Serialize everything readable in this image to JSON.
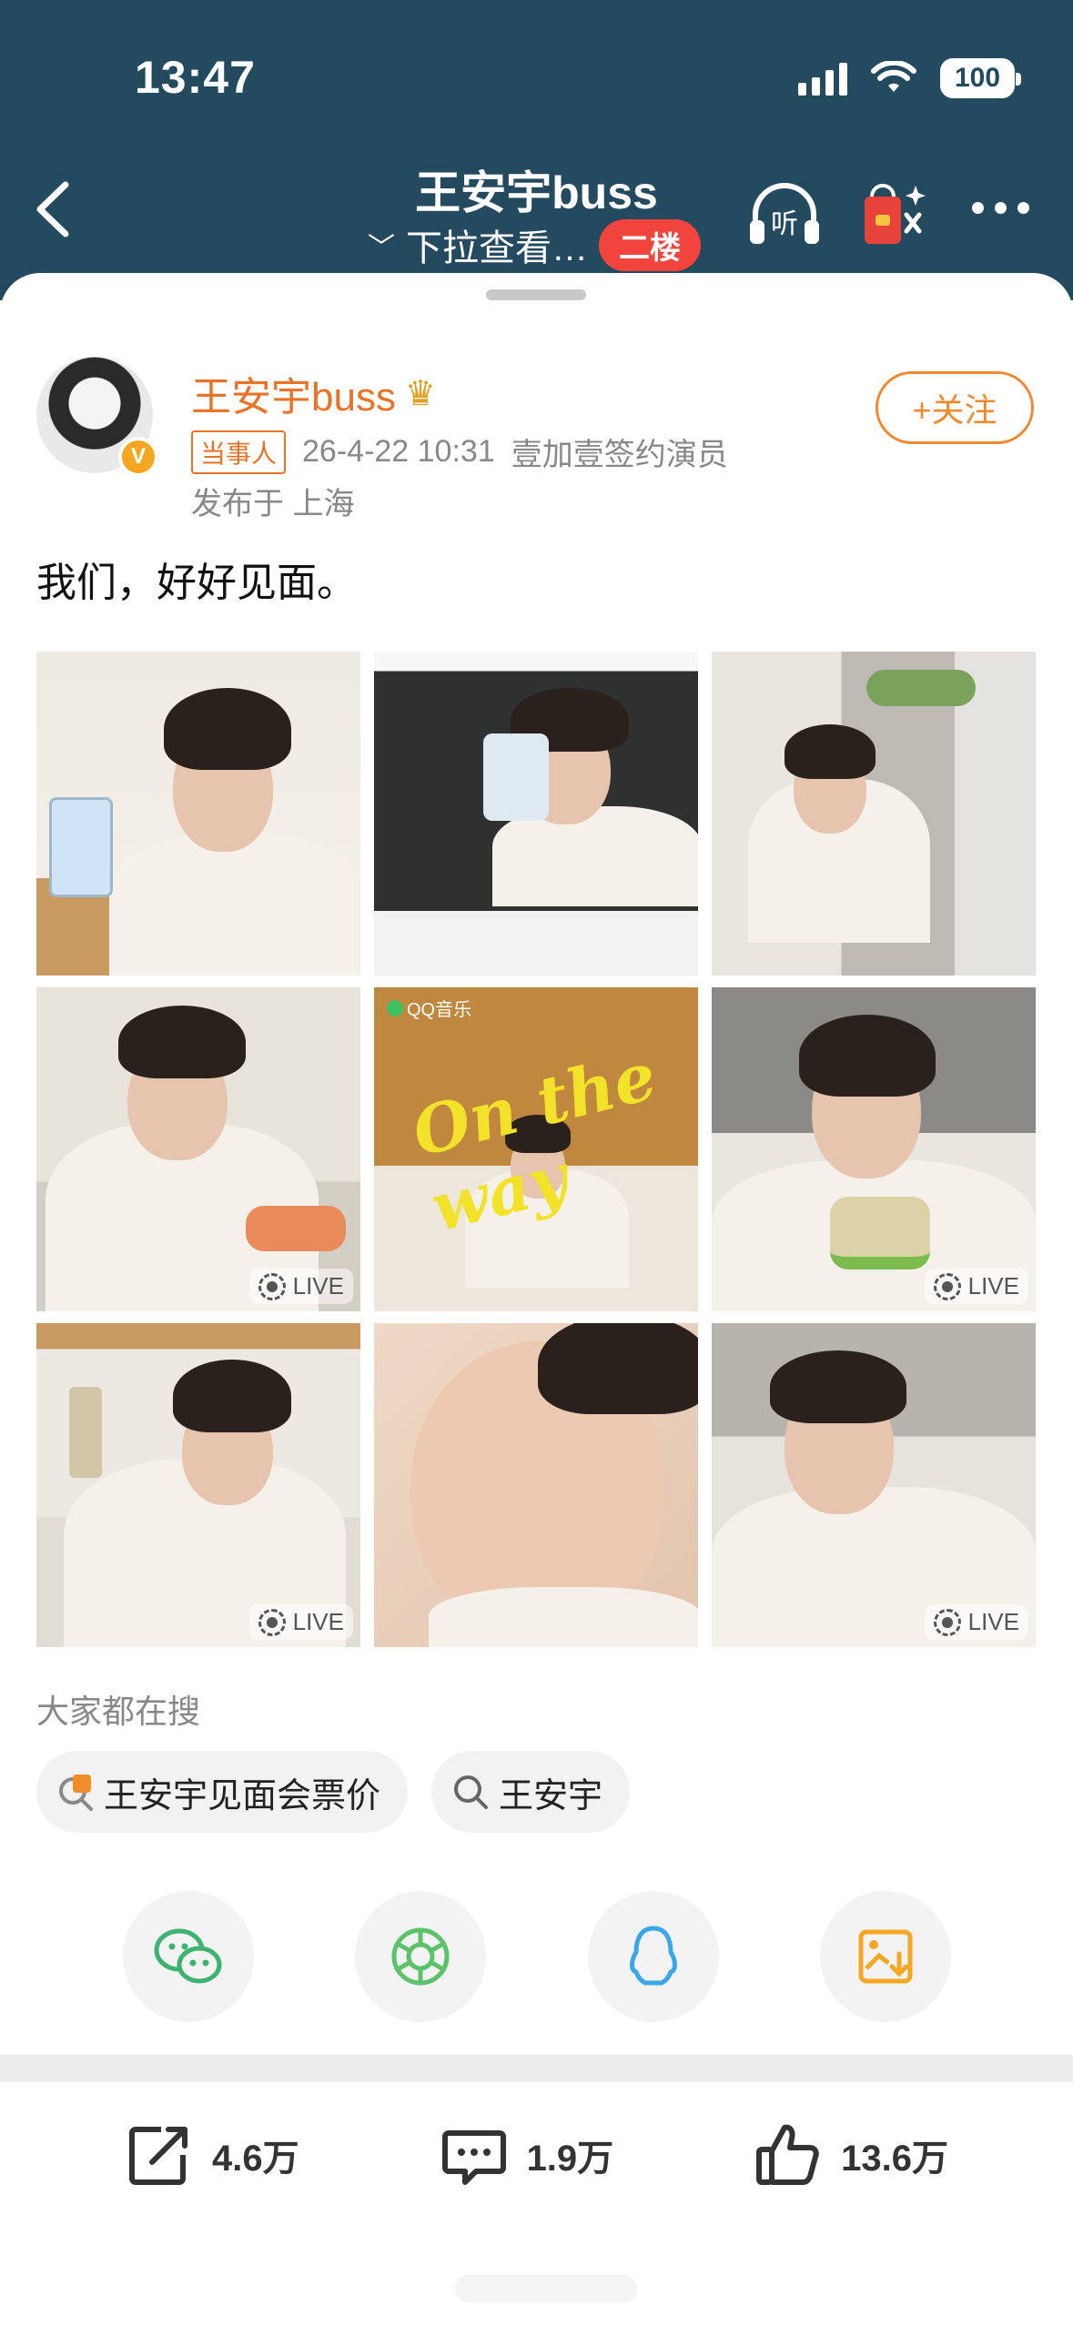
{
  "status_bar": {
    "time": "13:47",
    "battery": "100"
  },
  "nav": {
    "title": "王安宇buss",
    "subtitle": "下拉查看…",
    "floor_badge": "二楼",
    "listen_label": "听"
  },
  "post": {
    "author": "王安宇buss",
    "tag": "当事人",
    "timestamp": "26-4-22 10:31",
    "source": "壹加壹签约演员",
    "location": "发布于 上海",
    "follow_label": "+关注",
    "verified_mark": "V",
    "text": "我们，好好见面。",
    "live_label": "LIVE",
    "qq_music_mark": "QQ音乐",
    "artwork_text": "On the way"
  },
  "search": {
    "title": "大家都在搜",
    "chips": [
      {
        "label": "王安宇见面会票价",
        "icon": "hot-search-icon"
      },
      {
        "label": "王安宇",
        "icon": "search-icon"
      }
    ]
  },
  "share": {
    "targets": [
      "wechat-icon",
      "moments-icon",
      "qq-icon",
      "save-image-icon"
    ],
    "colors": {
      "wechat": "#3cb371",
      "moments": "#5cc36a",
      "qq": "#3aa8e8",
      "save": "#f5a623"
    }
  },
  "actions": {
    "reposts": "4.6万",
    "comments": "1.9万",
    "likes": "13.6万"
  },
  "colors": {
    "header_bg": "#244a60",
    "accent_orange": "#e8742a",
    "badge_red": "#f0443c"
  }
}
